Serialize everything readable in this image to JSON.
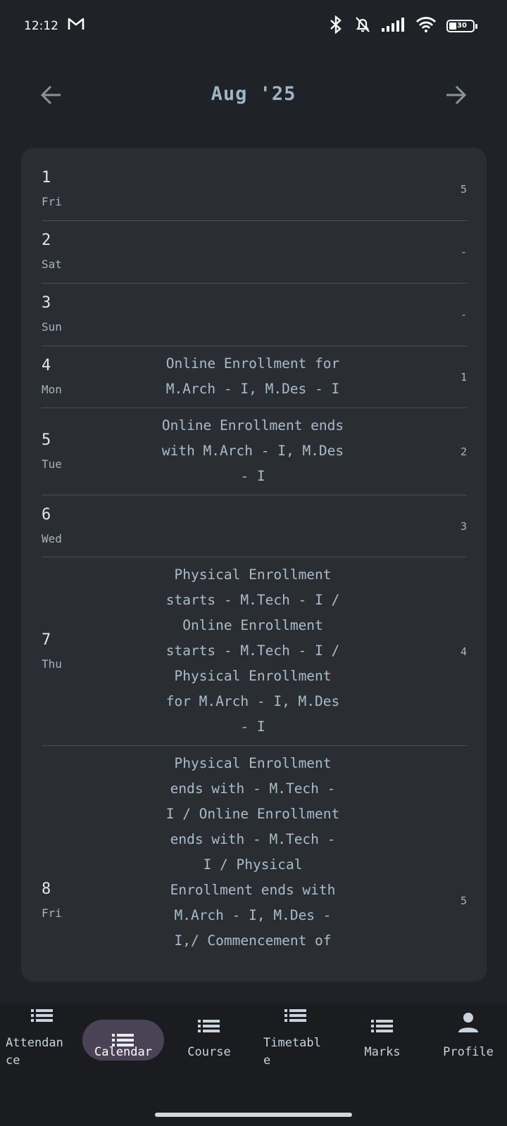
{
  "status_bar": {
    "time": "12:12",
    "battery": "30"
  },
  "header": {
    "title": "Aug '25",
    "prev_icon": "arrow-left-icon",
    "next_icon": "arrow-right-icon"
  },
  "calendar": {
    "rows": [
      {
        "day": "1",
        "dow": "Fri",
        "event": "",
        "count": "5"
      },
      {
        "day": "2",
        "dow": "Sat",
        "event": "",
        "count": "-"
      },
      {
        "day": "3",
        "dow": "Sun",
        "event": "",
        "count": "-"
      },
      {
        "day": "4",
        "dow": "Mon",
        "event": "Online Enrollment for\nM.Arch - I, M.Des - I",
        "count": "1"
      },
      {
        "day": "5",
        "dow": "Tue",
        "event": "Online Enrollment ends\nwith M.Arch - I, M.Des\n- I",
        "count": "2"
      },
      {
        "day": "6",
        "dow": "Wed",
        "event": "",
        "count": "3"
      },
      {
        "day": "7",
        "dow": "Thu",
        "event": "Physical Enrollment\nstarts - M.Tech - I /\nOnline Enrollment\nstarts - M.Tech - I /\nPhysical Enrollment\nfor M.Arch - I, M.Des\n- I",
        "count": "4"
      },
      {
        "day": "8",
        "dow": "Fri",
        "event": "Physical Enrollment\nends with - M.Tech -\nI / Online Enrollment\nends with - M.Tech -\nI / Physical\nEnrollment ends with\nM.Arch - I, M.Des -\nI,/ Commencement of",
        "count": "5"
      }
    ]
  },
  "nav": {
    "items": [
      {
        "label": "Attendan\nce",
        "icon": "list-icon"
      },
      {
        "label": "Calendar",
        "icon": "list-icon"
      },
      {
        "label": "Course",
        "icon": "list-icon"
      },
      {
        "label": "Timetabl\ne",
        "icon": "list-icon"
      },
      {
        "label": "Marks",
        "icon": "list-icon"
      },
      {
        "label": "Profile",
        "icon": "person-icon"
      }
    ],
    "active": "Calendar"
  }
}
